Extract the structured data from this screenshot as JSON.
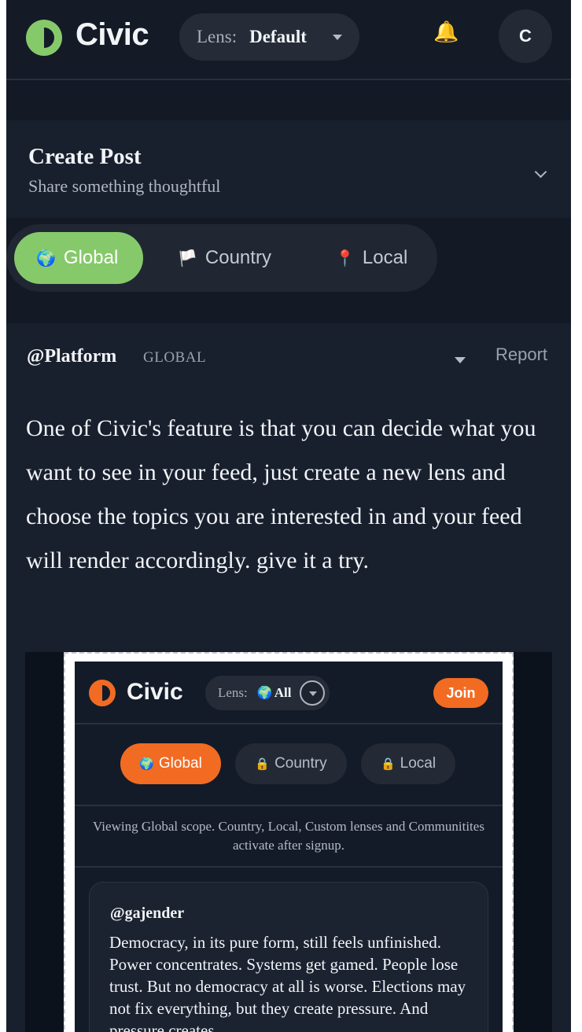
{
  "colors": {
    "background": "#131a26",
    "accent_green": "#86c96a",
    "accent_orange": "#f26b22"
  },
  "header": {
    "brand": "Civic",
    "logo_icon": "half-circle-logo-icon",
    "lens_label": "Lens:",
    "lens_value": "Default",
    "bell_icon": "🔔",
    "avatar_initial": "C"
  },
  "create_post": {
    "title": "Create Post",
    "subtitle": "Share something thoughtful"
  },
  "scopes": [
    {
      "icon": "🌍",
      "label": "Global",
      "active": true
    },
    {
      "icon": "🏳️",
      "label": "Country",
      "active": false
    },
    {
      "icon": "📍",
      "label": "Local",
      "active": false
    }
  ],
  "post": {
    "handle": "@Platform",
    "scope_tag": "GLOBAL",
    "report_label": "Report",
    "text": "One of Civic's feature is that you can decide what you want to see in your feed, just create a new lens and choose the topics you are interested in and your feed will render accordingly. give it a try.",
    "media": {
      "brand": "Civic",
      "lens_label": "Lens:",
      "lens_icon": "🌍",
      "lens_value": "All",
      "join_label": "Join",
      "scopes": [
        {
          "icon": "🌍",
          "label": "Global",
          "active": true
        },
        {
          "icon": "🔒",
          "label": "Country",
          "active": false
        },
        {
          "icon": "🔒",
          "label": "Local",
          "active": false
        }
      ],
      "note": "Viewing Global scope. Country, Local, Custom lenses and Communitites activate after signup.",
      "card_handle": "@gajender",
      "card_text": "Democracy, in its pure form, still feels unfinished. Power concentrates. Systems get gamed. People lose trust. But no democracy at all is worse. Elections may not fix everything, but they create pressure. And pressure creates"
    }
  }
}
